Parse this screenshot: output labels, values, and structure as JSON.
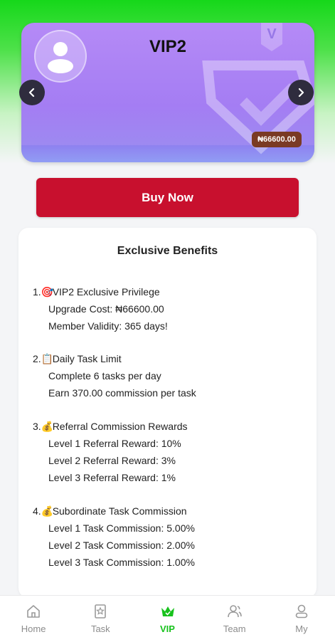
{
  "vip_card": {
    "title": "VIP2",
    "price_badge": "₦66600.00"
  },
  "buy_button": {
    "label": "Buy Now"
  },
  "benefits": {
    "title": "Exclusive Benefits",
    "sections": [
      {
        "number": "1.",
        "icon": "target-icon",
        "emoji": "🎯",
        "title": "VIP2 Exclusive Privilege",
        "lines": [
          "Upgrade Cost: ₦66600.00",
          "Member Validity: 365 days!"
        ]
      },
      {
        "number": "2.",
        "icon": "clipboard-icon",
        "emoji": "📋",
        "title": "Daily Task Limit",
        "lines": [
          "Complete 6 tasks per day",
          "Earn 370.00 commission per task"
        ]
      },
      {
        "number": "3.",
        "icon": "money-bag-icon",
        "emoji": "💰",
        "title": "Referral Commission Rewards",
        "lines": [
          "Level 1 Referral Reward: 10%",
          "Level 2 Referral Reward: 3%",
          "Level 3 Referral Reward: 1%"
        ]
      },
      {
        "number": "4.",
        "icon": "money-bag-icon",
        "emoji": "💰",
        "title": "Subordinate Task Commission",
        "lines": [
          "Level 1 Task Commission: 5.00%",
          "Level 2 Task Commission: 2.00%",
          "Level 3 Task Commission: 1.00%"
        ]
      }
    ]
  },
  "tabbar": {
    "items": [
      {
        "label": "Home",
        "icon": "home-icon",
        "active": false
      },
      {
        "label": "Task",
        "icon": "task-icon",
        "active": false
      },
      {
        "label": "VIP",
        "icon": "crown-icon",
        "active": true
      },
      {
        "label": "Team",
        "icon": "team-icon",
        "active": false
      },
      {
        "label": "My",
        "icon": "profile-icon",
        "active": false
      }
    ]
  },
  "colors": {
    "accent_green": "#17c21c",
    "buy_button": "#c8102e",
    "price_badge": "#7a3a24",
    "card_purple": "#a47df3"
  }
}
